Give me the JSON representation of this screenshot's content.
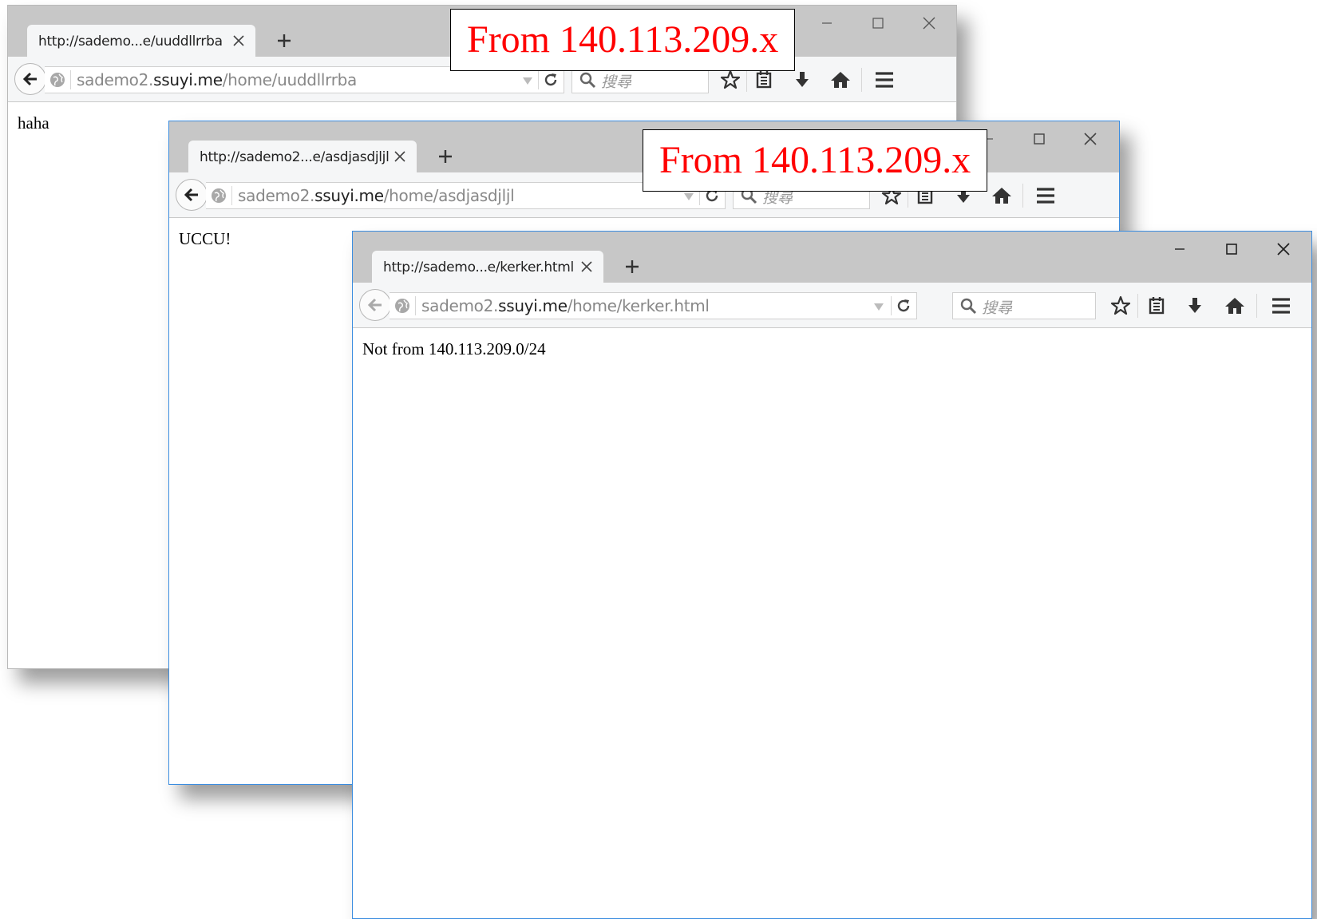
{
  "windows": [
    {
      "tab_title": "http://sademo...e/uuddllrrba",
      "url_prefix": "sademo2.",
      "url_domain": "ssuyi.me",
      "url_path": "/home/uuddllrrba",
      "search_placeholder": "搜尋",
      "content": "haha"
    },
    {
      "tab_title": "http://sademo2...e/asdjasdjljl",
      "url_prefix": "sademo2.",
      "url_domain": "ssuyi.me",
      "url_path": "/home/asdjasdjljl",
      "search_placeholder": "搜尋",
      "content": "UCCU!"
    },
    {
      "tab_title": "http://sademo...e/kerker.html",
      "url_prefix": "sademo2.",
      "url_domain": "ssuyi.me",
      "url_path": "/home/kerker.html",
      "search_placeholder": "搜尋",
      "content": "Not from 140.113.209.0/24"
    }
  ],
  "annotations": {
    "label1": "From 140.113.209.x",
    "label2": "From 140.113.209.x"
  },
  "colors": {
    "annotation_text": "#ff0000",
    "titlebar": "#c7c7c7",
    "toolbar": "#f5f6f7",
    "active_border": "#3b8de0"
  }
}
